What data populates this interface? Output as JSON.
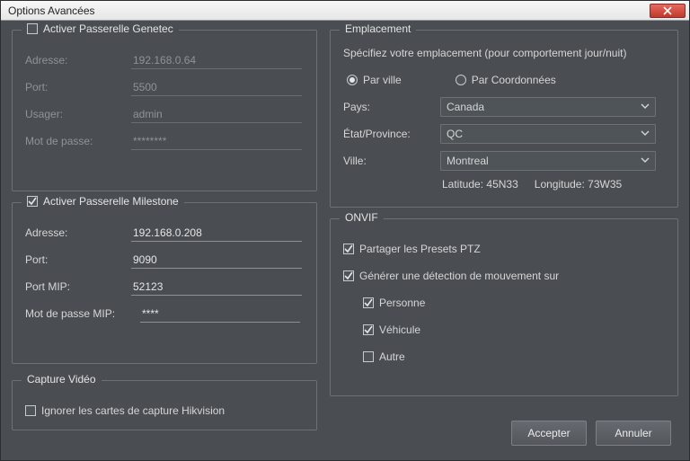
{
  "window": {
    "title": "Options Avancées"
  },
  "genetec": {
    "legend": "Activer Passerelle Genetec",
    "checked": false,
    "address_label": "Adresse:",
    "address_value": "192.168.0.64",
    "port_label": "Port:",
    "port_value": "5500",
    "user_label": "Usager:",
    "user_value": "admin",
    "pass_label": "Mot de passe:",
    "pass_value": "********"
  },
  "milestone": {
    "legend": "Activer Passerelle Milestone",
    "checked": true,
    "address_label": "Adresse:",
    "address_value": "192.168.0.208",
    "port_label": "Port:",
    "port_value": "9090",
    "portmip_label": "Port MIP:",
    "portmip_value": "52123",
    "passmip_label": "Mot de passe MIP:",
    "passmip_value": "****"
  },
  "capture": {
    "legend": "Capture Vidéo",
    "ignore_label": "Ignorer les cartes de capture Hikvision",
    "ignore_checked": false
  },
  "location": {
    "legend": "Emplacement",
    "hint": "Spécifiez votre emplacement (pour comportement jour/nuit)",
    "by_city_label": "Par ville",
    "by_coord_label": "Par Coordonnées",
    "by_city_selected": true,
    "country_label": "Pays:",
    "country_value": "Canada",
    "state_label": "État/Province:",
    "state_value": "QC",
    "city_label": "Ville:",
    "city_value": "Montreal",
    "lat_label": "Latitude:",
    "lat_value": "45N33",
    "lon_label": "Longitude:",
    "lon_value": "73W35"
  },
  "onvif": {
    "legend": "ONVIF",
    "share_ptz_label": "Partager les Presets PTZ",
    "share_ptz_checked": true,
    "motion_label": "Générer une détection de mouvement sur",
    "motion_checked": true,
    "person_label": "Personne",
    "person_checked": true,
    "vehicle_label": "Véhicule",
    "vehicle_checked": true,
    "other_label": "Autre",
    "other_checked": false
  },
  "buttons": {
    "accept": "Accepter",
    "cancel": "Annuler"
  }
}
